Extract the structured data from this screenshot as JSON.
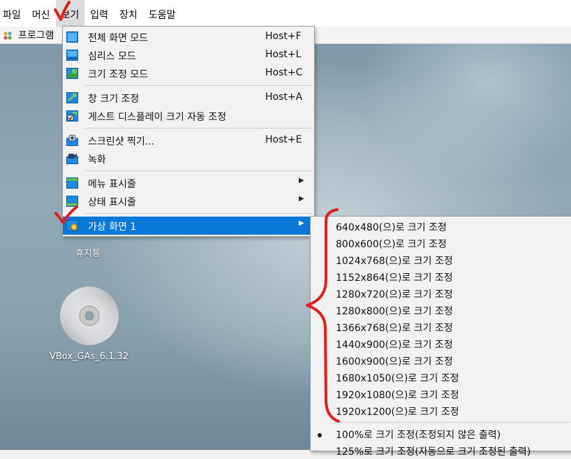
{
  "menubar": {
    "items": [
      {
        "label": "파일"
      },
      {
        "label": "머신"
      },
      {
        "label": "보기"
      },
      {
        "label": "입력"
      },
      {
        "label": "장치"
      },
      {
        "label": "도움말"
      }
    ]
  },
  "program_bar": {
    "label": "프로그램"
  },
  "desktop": {
    "recycle_label": "휴지통",
    "cd_label": "VBox_GAs_6.1.32"
  },
  "view_menu": {
    "items": [
      {
        "label": "전체 화면 모드",
        "shortcut": "Host+F",
        "icon": "fullscreen-icon"
      },
      {
        "label": "심리스 모드",
        "shortcut": "Host+L",
        "icon": "seamless-icon"
      },
      {
        "label": "크기 조정 모드",
        "shortcut": "Host+C",
        "icon": "scale-icon"
      },
      {
        "label": "창 크기 조정",
        "shortcut": "Host+A",
        "icon": "adjust-window-icon"
      },
      {
        "label": "게스트 디스플레이 크기 자동 조정",
        "shortcut": "",
        "icon": "auto-resize-icon"
      },
      {
        "label": "스크린샷 찍기...",
        "shortcut": "Host+E",
        "icon": "screenshot-icon"
      },
      {
        "label": "녹화",
        "shortcut": "",
        "icon": "record-icon"
      },
      {
        "label": "메뉴 표시줄",
        "shortcut": "",
        "icon": "menubar-icon"
      },
      {
        "label": "상태 표시줄",
        "shortcut": "",
        "icon": "statusbar-icon"
      },
      {
        "label": "가상 화면 1",
        "shortcut": "",
        "icon": "virtual-screen-icon"
      }
    ]
  },
  "submenu": {
    "items": [
      {
        "label": "640x480(으)로 크기 조정"
      },
      {
        "label": "800x600(으)로 크기 조정"
      },
      {
        "label": "1024x768(으)로 크기 조정"
      },
      {
        "label": "1152x864(으)로 크기 조정"
      },
      {
        "label": "1280x720(으)로 크기 조정"
      },
      {
        "label": "1280x800(으)로 크기 조정"
      },
      {
        "label": "1366x768(으)로 크기 조정"
      },
      {
        "label": "1440x900(으)로 크기 조정"
      },
      {
        "label": "1600x900(으)로 크기 조정"
      },
      {
        "label": "1680x1050(으)로 크기 조정"
      },
      {
        "label": "1920x1080(으)로 크기 조정"
      },
      {
        "label": "1920x1200(으)로 크기 조정"
      }
    ],
    "scale_items": [
      {
        "label": "100%로 크기 조정(조정되지 않은 출력)",
        "selected": true
      },
      {
        "label": "125%로 크기 조정(자동으로 크기 조정된 출력)",
        "selected": false
      }
    ]
  },
  "colors": {
    "highlight": "#0a78d7",
    "annotation": "#e0201e"
  }
}
